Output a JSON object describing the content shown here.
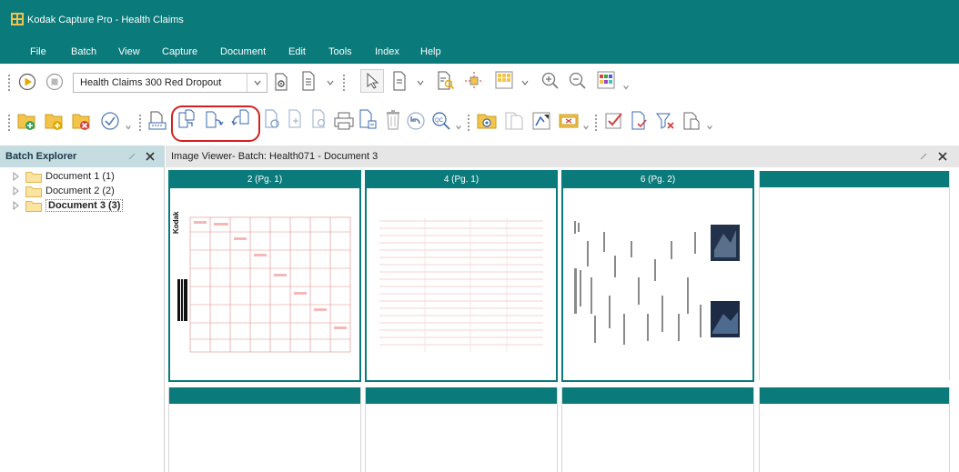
{
  "window": {
    "title": "Kodak Capture Pro - Health Claims"
  },
  "menu": {
    "items": [
      "File",
      "Batch",
      "View",
      "Capture",
      "Document",
      "Edit",
      "Tools",
      "Index",
      "Help"
    ]
  },
  "toolbar1": {
    "setup_value": "Health Claims 300 Red Dropout"
  },
  "batch_explorer": {
    "title": "Batch Explorer",
    "items": [
      {
        "label": "Document 1 (1)",
        "bold": false
      },
      {
        "label": "Document 2 (2)",
        "bold": false
      },
      {
        "label": "Document 3 (3)",
        "bold": true
      }
    ]
  },
  "viewer": {
    "title": "Image Viewer- Batch: Health071 - Document 3",
    "thumbs": [
      {
        "caption": "2 (Pg. 1)"
      },
      {
        "caption": "4 (Pg. 1)"
      },
      {
        "caption": "6 (Pg. 2)"
      }
    ],
    "page_logo": "Kodak"
  },
  "colors": {
    "teal": "#0a7a7a",
    "highlight_red": "#d42020"
  }
}
